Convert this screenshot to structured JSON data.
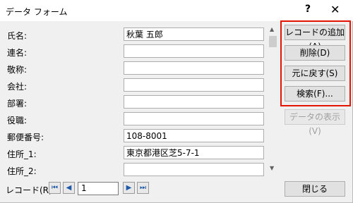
{
  "window": {
    "title": "データ フォーム",
    "help": "?",
    "close": "✕"
  },
  "fields": [
    {
      "label": "氏名:",
      "value": "秋葉 五郎"
    },
    {
      "label": "連名:",
      "value": ""
    },
    {
      "label": "敬称:",
      "value": ""
    },
    {
      "label": "会社:",
      "value": ""
    },
    {
      "label": "部署:",
      "value": ""
    },
    {
      "label": "役職:",
      "value": ""
    },
    {
      "label": "郵便番号:",
      "value": "108-8001"
    },
    {
      "label": "住所_1:",
      "value": "東京都港区芝5-7-1"
    },
    {
      "label": "住所_2:",
      "value": ""
    }
  ],
  "buttons": {
    "add": "レコードの追加(A)",
    "delete": "削除(D)",
    "restore": "元に戻す(S)",
    "search": "検索(F)...",
    "show_data": "データの表示(V)",
    "close": "閉じる"
  },
  "record": {
    "label": "レコード(R):",
    "value": "1"
  },
  "icons": {
    "first": "⏮",
    "prev": "◀",
    "next": "▶",
    "last": "⏭",
    "scroll_up": "▲",
    "scroll_down": "▼"
  },
  "colors": {
    "highlight": "#e51400",
    "nav": "#1e5aa8"
  }
}
